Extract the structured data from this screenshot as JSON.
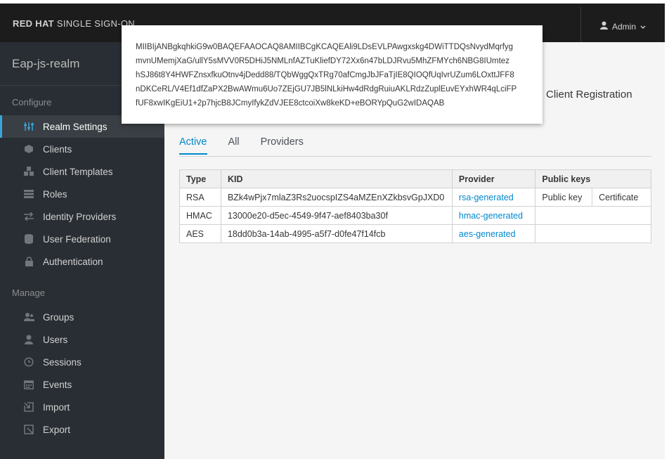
{
  "header": {
    "brand_bold": "RED HAT",
    "brand_rest": "SINGLE SIGN-ON",
    "user": "Admin"
  },
  "sidebar": {
    "realm": "Eap-js-realm",
    "configure_label": "Configure",
    "manage_label": "Manage",
    "configure_items": [
      {
        "label": "Realm Settings",
        "icon": "sliders-icon",
        "active": true
      },
      {
        "label": "Clients",
        "icon": "cube-icon"
      },
      {
        "label": "Client Templates",
        "icon": "cubes-icon"
      },
      {
        "label": "Roles",
        "icon": "list-icon"
      },
      {
        "label": "Identity Providers",
        "icon": "exchange-icon"
      },
      {
        "label": "User Federation",
        "icon": "database-icon"
      },
      {
        "label": "Authentication",
        "icon": "lock-icon"
      }
    ],
    "manage_items": [
      {
        "label": "Groups",
        "icon": "group-icon"
      },
      {
        "label": "Users",
        "icon": "user-icon"
      },
      {
        "label": "Sessions",
        "icon": "clock-icon"
      },
      {
        "label": "Events",
        "icon": "calendar-icon"
      },
      {
        "label": "Import",
        "icon": "import-icon"
      },
      {
        "label": "Export",
        "icon": "export-icon"
      }
    ]
  },
  "main": {
    "partial_tab": "Client Registration",
    "tabs": [
      "Active",
      "All",
      "Providers"
    ],
    "table": {
      "headers": [
        "Type",
        "KID",
        "Provider",
        "Public keys"
      ],
      "rows": [
        {
          "type": "RSA",
          "kid": "BZk4wPjx7mlaZ3Rs2uocspIZS4aMZEnXZkbsvGpJXD0",
          "provider": "rsa-generated",
          "key1": "Public key",
          "key2": "Certificate"
        },
        {
          "type": "HMAC",
          "kid": "13000e20-d5ec-4549-9f47-aef8403ba30f",
          "provider": "hmac-generated",
          "key1": "",
          "key2": ""
        },
        {
          "type": "AES",
          "kid": "18dd0b3a-14ab-4995-a5f7-d0fe47f14fcb",
          "provider": "aes-generated",
          "key1": "",
          "key2": ""
        }
      ]
    }
  },
  "popover": {
    "lines": [
      "MIIBIjANBgkqhkiG9w0BAQEFAAOCAQ8AMIIBCgKCAQEAli9LDsEVLPAwgxskg4DWiTTDQsNvydMqrfyg",
      "mvnUMemjXaG/ullY5sMVV0R5DHiJ5NMLnfAZTuKliefDY72Xx6n47bLDJRvu5MhZFMYch6NBG8IUmtez",
      "hSJ86t8Y4HWFZnsxfkuOtnv4jDedd88/TQbWggQxTRg70afCmgJbJFaTjIE8QIOQfUqIvrUZum6LOxttJFF8",
      "nDKCeRL/V4Ef1dfZaPX2BwAWmu6Uo7ZEjGU7JB5lNLkiHw4dRdgRuiuAKLRdzZuplEuvEYxhWR4qLciFP",
      "fUF8xwIKgEiU1+2p7hjcB8JCmyIfykZdVJEE8ctcoiXw8keKD+eBORYpQuG2wIDAQAB"
    ]
  }
}
